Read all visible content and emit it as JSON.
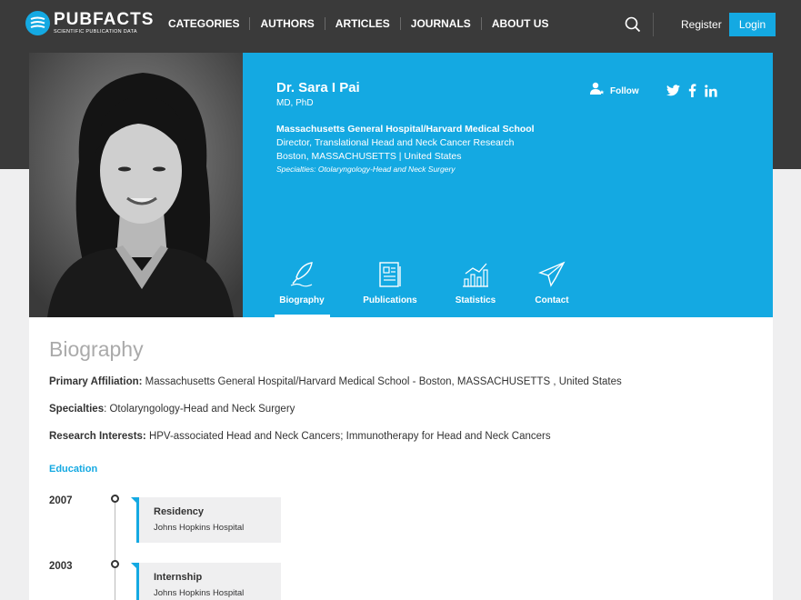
{
  "brand": {
    "name": "PUBFACTS",
    "tagline": "SCIENTIFIC PUBLICATION DATA"
  },
  "nav": {
    "items": [
      {
        "label": "CATEGORIES"
      },
      {
        "label": "AUTHORS"
      },
      {
        "label": "ARTICLES"
      },
      {
        "label": "JOURNALS"
      },
      {
        "label": "ABOUT US"
      }
    ],
    "register_label": "Register",
    "login_label": "Login"
  },
  "profile": {
    "name": "Dr. Sara I Pai",
    "degree": "MD, PhD",
    "affiliation": "Massachusetts General Hospital/Harvard Medical School",
    "title": "Director, Translational Head and Neck Cancer Research",
    "location": "Boston, MASSACHUSETTS | United States",
    "specialties": "Specialties: Otolaryngology-Head and Neck Surgery",
    "follow_label": "Follow"
  },
  "tabs": [
    {
      "label": "Biography",
      "icon": "quill-icon",
      "active": true
    },
    {
      "label": "Publications",
      "icon": "document-icon",
      "active": false
    },
    {
      "label": "Statistics",
      "icon": "chart-icon",
      "active": false
    },
    {
      "label": "Contact",
      "icon": "paper-plane-icon",
      "active": false
    }
  ],
  "biography": {
    "heading": "Biography",
    "primary_affiliation_label": "Primary Affiliation:",
    "primary_affiliation_value": " Massachusetts General Hospital/Harvard Medical School - Boston, MASSACHUSETTS , United States",
    "specialties_label": "Specialties",
    "specialties_value": ": Otolaryngology-Head and Neck Surgery",
    "research_label": "Research Interests:",
    "research_value": " HPV-associated Head and Neck Cancers; Immunotherapy for Head and Neck Cancers",
    "education_heading": "Education",
    "education": [
      {
        "year": "2007",
        "title": "Residency",
        "institution": "Johns Hopkins Hospital"
      },
      {
        "year": "2003",
        "title": "Internship",
        "institution": "Johns Hopkins Hospital"
      }
    ]
  },
  "colors": {
    "accent": "#14a9e2",
    "dark": "#3a3a3a",
    "background": "#efeff0"
  }
}
